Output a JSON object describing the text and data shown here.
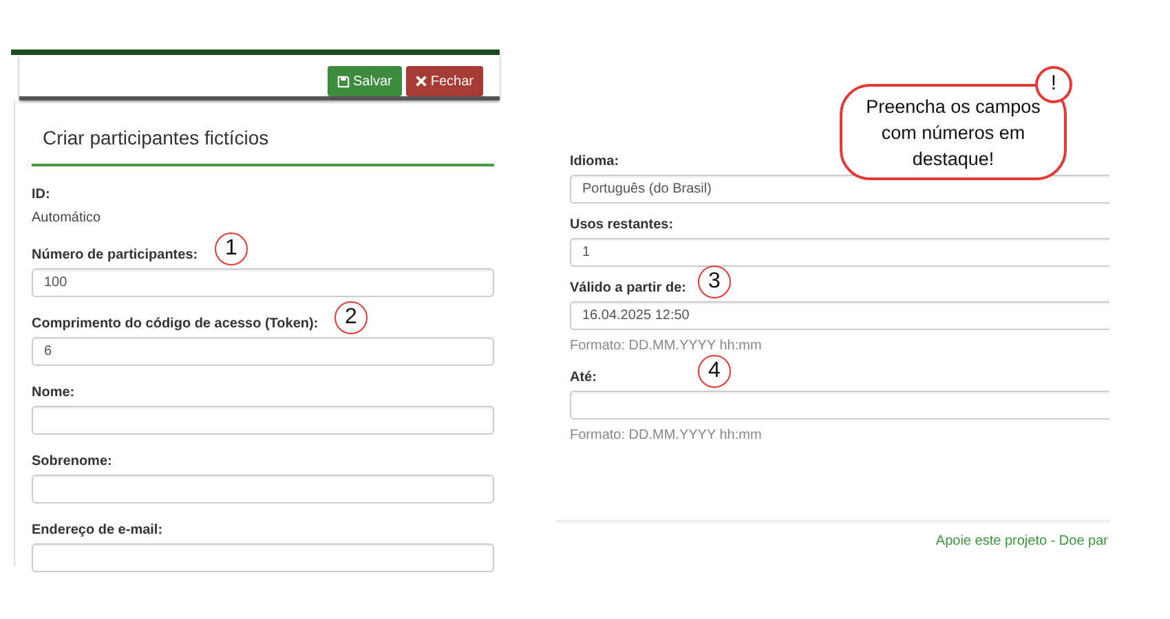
{
  "toolbar": {
    "buttons": [
      {
        "kind": "save",
        "label": "Salvar"
      },
      {
        "kind": "close",
        "label": "Fechar"
      }
    ]
  },
  "form_title": "Criar participantes fictícios",
  "left_fields": [
    {
      "kind": "static",
      "label": "ID:",
      "value": "Automático"
    },
    {
      "kind": "input",
      "label": "Número de participantes:",
      "value": "100",
      "marker": "1"
    },
    {
      "kind": "input",
      "label": "Comprimento do código de acesso (Token):",
      "value": "6",
      "marker": "2"
    },
    {
      "kind": "input",
      "label": "Nome:"
    },
    {
      "kind": "input",
      "label": "Sobrenome:"
    },
    {
      "kind": "input",
      "label": "Endereço de e-mail:"
    }
  ],
  "right_fields": [
    {
      "kind": "input",
      "label": "Idioma:",
      "value": "Português (do Brasil)"
    },
    {
      "kind": "input",
      "label": "Usos restantes:",
      "value": "1"
    },
    {
      "kind": "input",
      "label": "Válido a partir de:",
      "value": "16.04.2025 12:50",
      "marker": "3",
      "hint": "Formato: DD.MM.YYYY hh:mm"
    },
    {
      "kind": "input",
      "label": "Até:",
      "marker": "4",
      "hint": "Formato: DD.MM.YYYY hh:mm"
    }
  ],
  "footer_link": "Apoie este projeto - Doe par",
  "callout": {
    "text": "Preencha os campos com números em destaque!",
    "badge": "!"
  }
}
